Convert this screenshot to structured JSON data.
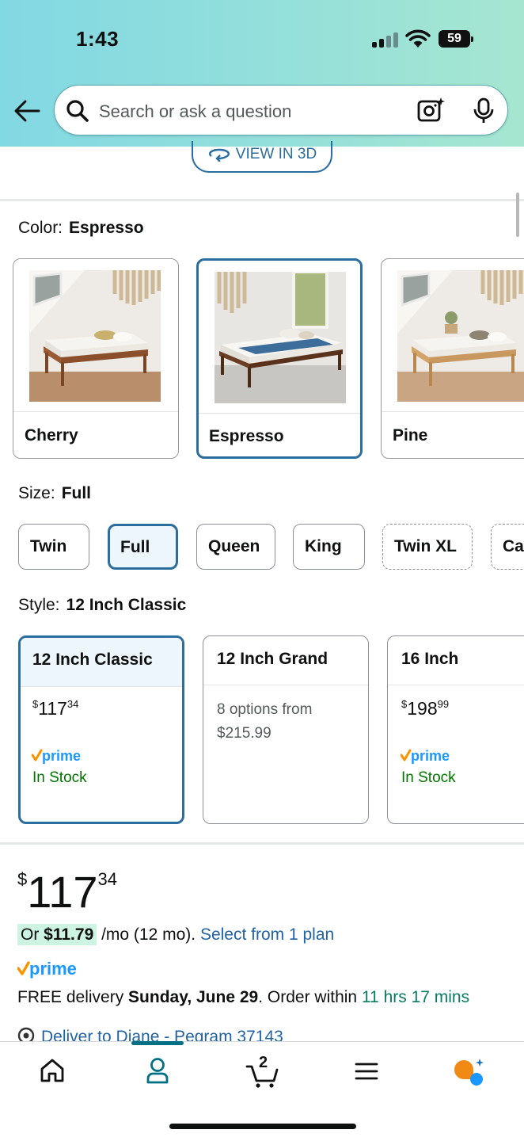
{
  "status_bar": {
    "time": "1:43",
    "battery": "59"
  },
  "search": {
    "placeholder": "Search or ask a question"
  },
  "view3d": {
    "label": "VIEW IN 3D"
  },
  "color": {
    "label": "Color:",
    "selected": "Espresso",
    "options": [
      "Cherry",
      "Espresso",
      "Pine"
    ]
  },
  "size": {
    "label": "Size:",
    "selected": "Full",
    "options": [
      "Twin",
      "Full",
      "Queen",
      "King",
      "Twin XL",
      "Ca"
    ]
  },
  "style": {
    "label": "Style:",
    "selected": "12 Inch Classic",
    "cards": [
      {
        "title": "12 Inch Classic",
        "currency": "$",
        "price_whole": "117",
        "price_cents": "34",
        "prime": "prime",
        "stock": "In Stock"
      },
      {
        "title": "12 Inch Grand",
        "options_line1": "8 options from",
        "options_line2": "$215.99"
      },
      {
        "title": "16 Inch",
        "currency": "$",
        "price_whole": "198",
        "price_cents": "99",
        "prime": "prime",
        "stock": "In Stock"
      }
    ]
  },
  "price": {
    "currency": "$",
    "whole": "117",
    "cents": "34",
    "installment_prefix": "Or ",
    "installment_amount": "$11.79",
    "installment_suffix": " /mo (12 mo). ",
    "installment_link": "Select from 1 plan",
    "prime": "prime"
  },
  "delivery": {
    "prefix": "FREE delivery ",
    "date": "Sunday, June 29",
    "middle": ". Order within ",
    "countdown": "11 hrs 17 mins",
    "deliver_to": "Deliver to Diane - Pegram 37143"
  },
  "nav": {
    "cart_count": "2"
  },
  "colors": {
    "accent": "#2a6d9e",
    "link": "#2162a1",
    "prime_blue": "#1a98ff",
    "prime_orange": "#f79400",
    "stock_green": "#007600"
  }
}
